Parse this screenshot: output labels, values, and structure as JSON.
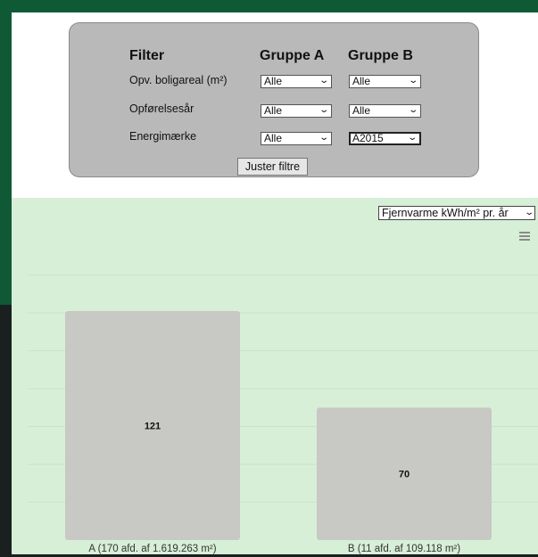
{
  "filter": {
    "header": "Filter",
    "group_a": "Gruppe A",
    "group_b": "Gruppe B",
    "rows": [
      {
        "label": "Opv. boligareal (m²)",
        "a": "Alle",
        "b": "Alle"
      },
      {
        "label": "Opførelsesår",
        "a": "Alle",
        "b": "Alle"
      },
      {
        "label": "Energimærke",
        "a": "Alle",
        "b": "A2015"
      }
    ],
    "apply_label": "Juster filtre"
  },
  "chart_controls": {
    "metric": "Fjernvarme kWh/m² pr. år",
    "menu_icon": "hamburger-menu-icon"
  },
  "chart_data": {
    "type": "bar",
    "categories": [
      "A (170 afd. af 1.619.263 m²)",
      "B (11 afd. af 109.118 m²)"
    ],
    "values": [
      121,
      70
    ],
    "ylim": [
      0,
      140
    ],
    "grid": true,
    "bar_color": "#c8c8c4",
    "title": "",
    "xlabel": "",
    "ylabel": ""
  }
}
